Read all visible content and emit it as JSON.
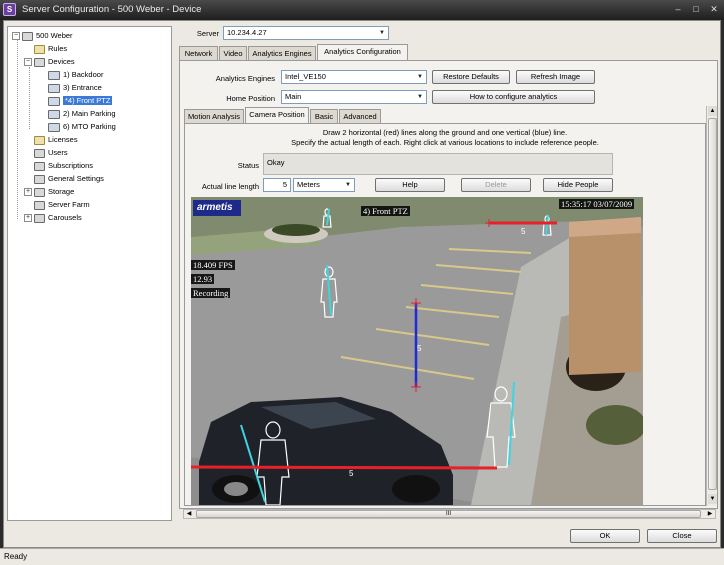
{
  "window": {
    "title": "Server Configuration - 500 Weber - Device",
    "app_icon": "S"
  },
  "tree": {
    "root": "500 Weber",
    "items": {
      "rules": "Rules",
      "devices": "Devices",
      "backdoor": "1) Backdoor",
      "entrance": "3) Entrance",
      "front_ptz": "*4) Front PTZ",
      "main_parking": "2) Main Parking",
      "mto_parking": "6) MTO Parking",
      "licenses": "Licenses",
      "users": "Users",
      "subscriptions": "Subscriptions",
      "general_settings": "General Settings",
      "storage": "Storage",
      "server_farm": "Server Farm",
      "carousels": "Carousels"
    }
  },
  "server": {
    "label": "Server",
    "value": "10.234.4.27"
  },
  "top_tabs": {
    "network": "Network",
    "video": "Video",
    "engines": "Analytics Engines",
    "config": "Analytics Configuration"
  },
  "analytics": {
    "engines_label": "Analytics Engines",
    "engines_value": "Intel_VE150",
    "home_label": "Home Position",
    "home_value": "Main",
    "restore_btn": "Restore Defaults",
    "refresh_btn": "Refresh Image",
    "howto_btn": "How to configure analytics"
  },
  "sub_tabs": {
    "motion": "Motion Analysis",
    "camera": "Camera Position",
    "basic": "Basic",
    "advanced": "Advanced"
  },
  "camera_position": {
    "instruction_1": "Draw 2 horizontal (red) lines along the ground and one vertical (blue) line.",
    "instruction_2": "Specify the actual length of each. Right click at various locations to include reference people.",
    "status_label": "Status",
    "status_value": "Okay",
    "length_label": "Actual line length",
    "length_value": "5",
    "unit_value": "Meters",
    "help_btn": "Help",
    "delete_btn": "Delete",
    "hide_people_btn": "Hide People"
  },
  "video": {
    "brand": "armetis",
    "camera_name": "4) Front PTZ",
    "timestamp": "15:35:17 03/07/2009",
    "fps": "18.409 FPS",
    "stat2": "12.93",
    "recording": "Recording",
    "line_len_top": "5",
    "line_len_vertical": "5",
    "line_len_bottom": "5"
  },
  "scroll_grip": "III",
  "buttons": {
    "ok": "OK",
    "close": "Close"
  },
  "status_bar": "Ready",
  "colors": {
    "red_line": "#e8202a",
    "blue_line": "#1c2ad8",
    "cyan_person": "#3fd5e0",
    "selection": "#3b78d8"
  }
}
